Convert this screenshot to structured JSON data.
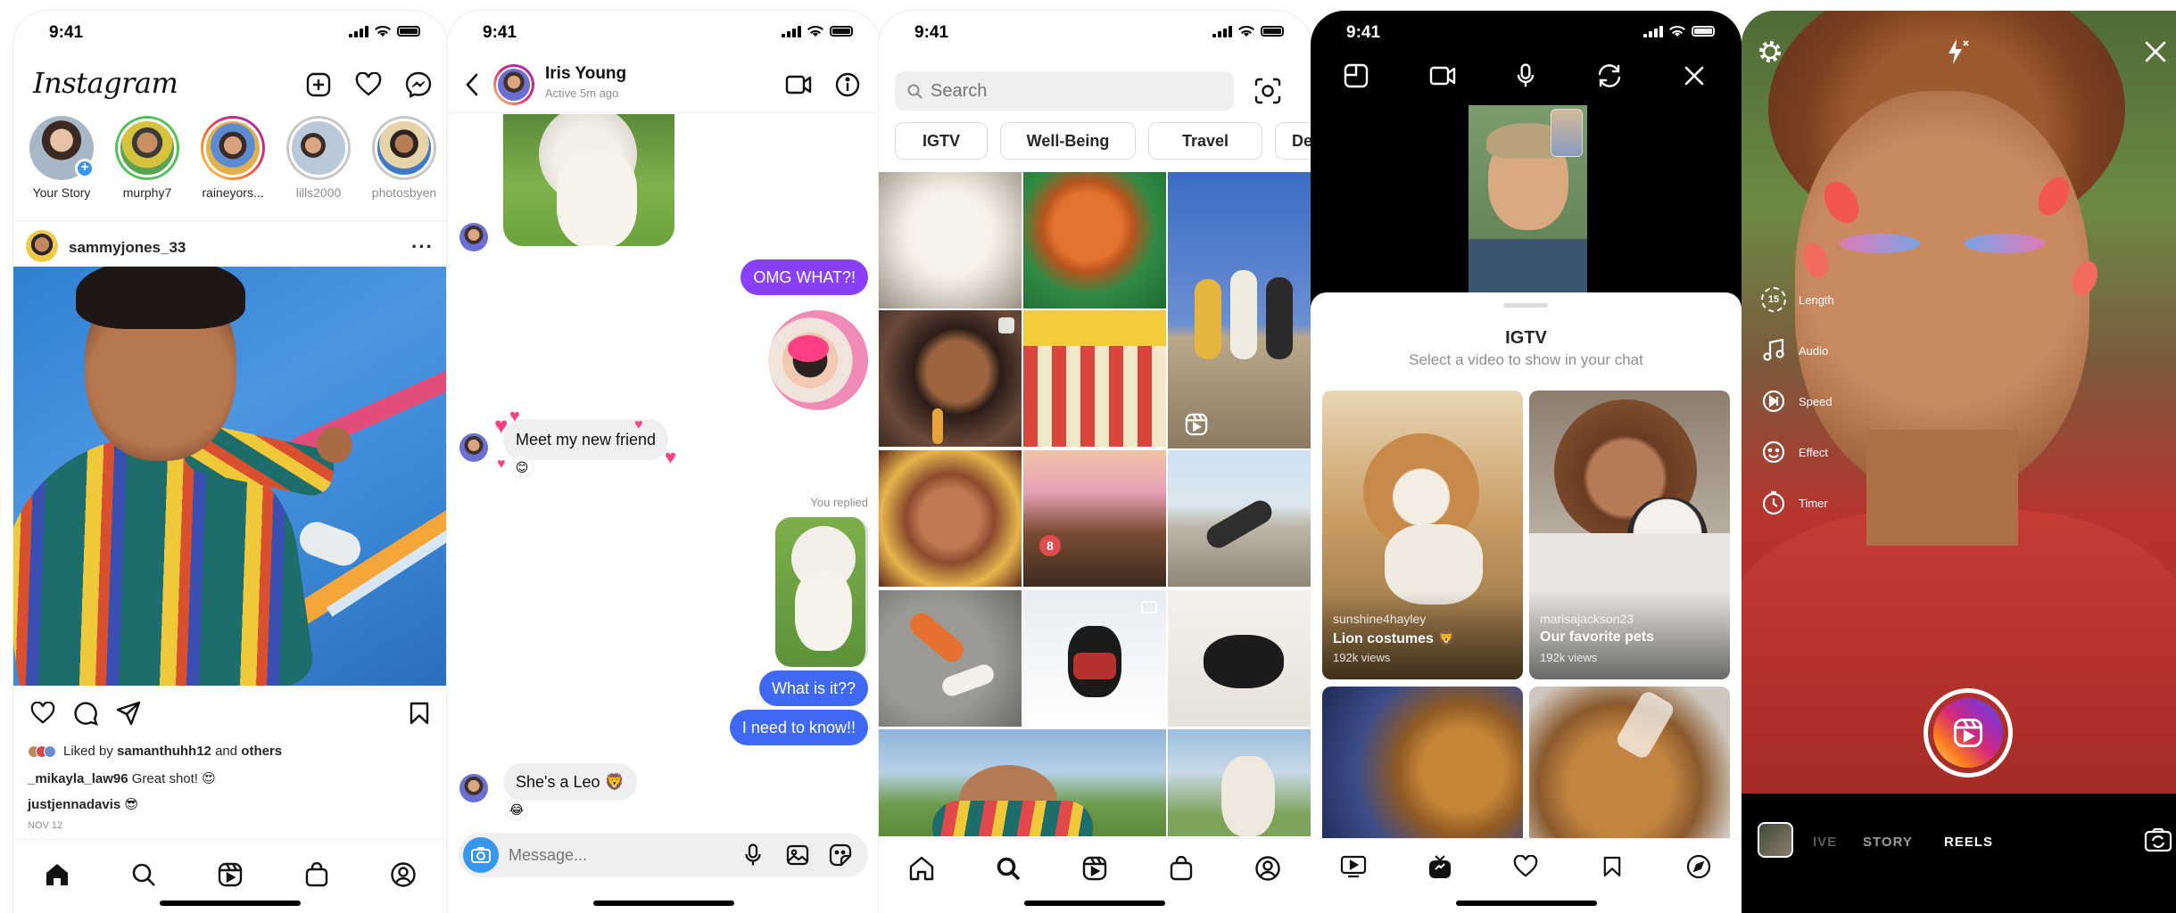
{
  "status": {
    "time": "9:41"
  },
  "feed": {
    "logo": "Instagram",
    "stories": [
      {
        "name": "Your Story"
      },
      {
        "name": "murphy7"
      },
      {
        "name": "raineyors..."
      },
      {
        "name": "lills2000"
      },
      {
        "name": "photosbyen"
      }
    ],
    "post_user": "sammyjones_33",
    "liked_by_prefix": "Liked by",
    "liked_by_user": "samanthuhh12",
    "liked_by_and": "and",
    "liked_by_others": "others",
    "comment1_user": "_mikayla_law96",
    "comment1_text": "Great shot! 😍",
    "comment2_user": "justjennadavis",
    "comment2_text": "😎",
    "date": "NOV 12"
  },
  "dm": {
    "contact_name": "Iris Young",
    "contact_status": "Active 5m ago",
    "msg_omg": "OMG WHAT?!",
    "msg_meet": "Meet my new friend",
    "reaction_meet": "😊",
    "you_replied": "You replied",
    "msg_whatisit": "What is it??",
    "msg_needtoknow": "I need to know!!",
    "msg_leo": "She's a Leo 🦁",
    "reaction_leo": "😂",
    "message_placeholder": "Message..."
  },
  "explore": {
    "search_placeholder": "Search",
    "chips": [
      "IGTV",
      "Well-Being",
      "Travel",
      "De"
    ]
  },
  "igtv": {
    "sheet_title": "IGTV",
    "sheet_subtitle": "Select a video to show in your chat",
    "videos": [
      {
        "user": "sunshine4hayley",
        "title": "Lion costumes 🦁",
        "views": "192k views"
      },
      {
        "user": "marisajackson23",
        "title": "Our favorite pets",
        "views": "192k views"
      }
    ]
  },
  "camera": {
    "tools": [
      {
        "label": "Length",
        "badge": "15"
      },
      {
        "label": "Audio"
      },
      {
        "label": "Speed"
      },
      {
        "label": "Effect"
      },
      {
        "label": "Timer"
      }
    ],
    "modes": [
      "IVE",
      "STORY",
      "REELS"
    ]
  },
  "colors": {
    "ig_blue": "#3797f0",
    "ig_purple": "#8a3ffc",
    "ig_gradient_start": "#feda75",
    "ig_gradient_end": "#d62976"
  }
}
